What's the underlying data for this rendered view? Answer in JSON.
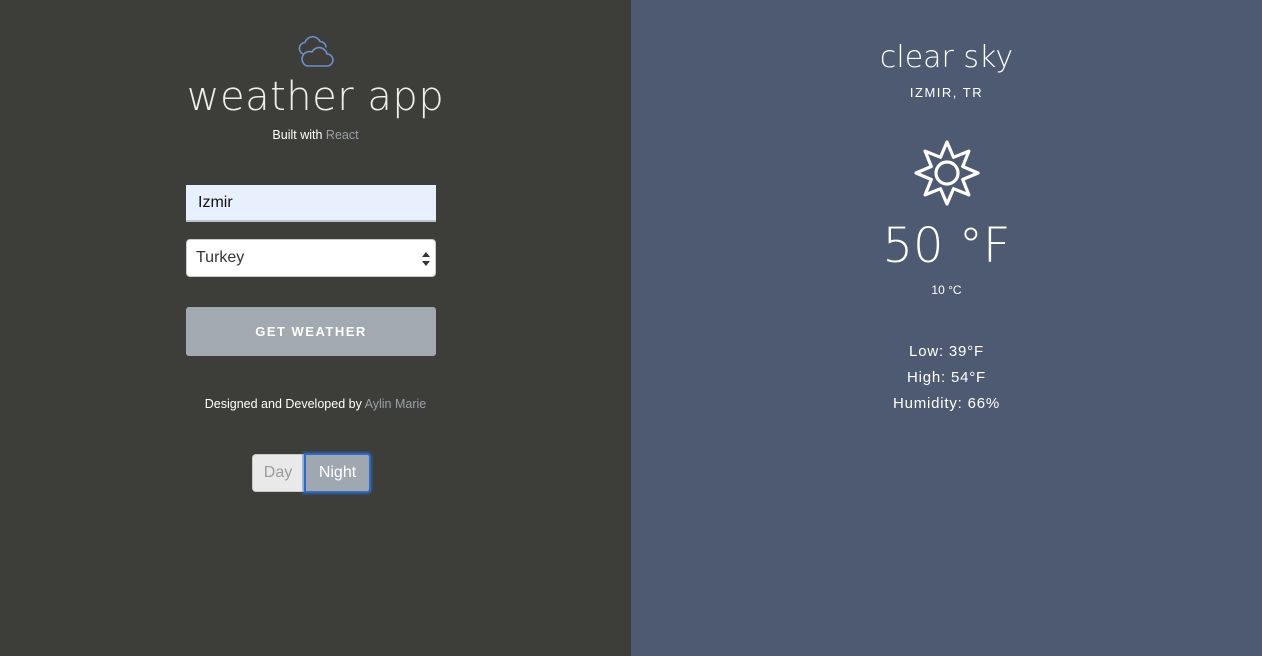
{
  "app": {
    "title": "weather app",
    "built_with_prefix": "Built with ",
    "built_with_link": "React",
    "icon": "cloud-icon"
  },
  "form": {
    "city_value": "Izmir",
    "country_selected": "Turkey",
    "submit_label": "GET WEATHER"
  },
  "footer": {
    "designed_prefix": "Designed and Developed by ",
    "designed_link": "Aylin Marie"
  },
  "theme_toggle": {
    "day_label": "Day",
    "night_label": "Night",
    "active": "Night"
  },
  "weather": {
    "description": "clear sky",
    "location": "IZMIR, TR",
    "icon": "sun-icon",
    "temp_f": "50 °F",
    "temp_c": "10 °C",
    "low": "Low: 39°F",
    "high": "High: 54°F",
    "humidity": "Humidity: 66%"
  },
  "colors": {
    "left_bg": "#3d3d39",
    "right_bg": "#4e5a72",
    "accent_icon": "#6f8fc9",
    "button_bg": "#a3a9b0",
    "input_bg": "#e8f0fe",
    "toggle_focus": "#2f6bc4"
  }
}
